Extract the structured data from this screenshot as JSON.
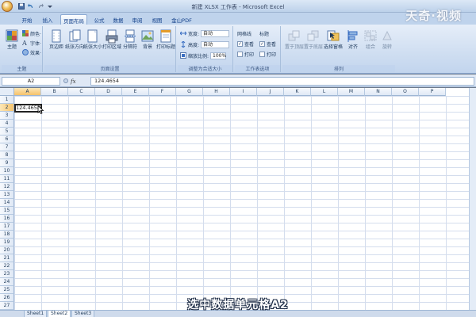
{
  "window": {
    "title": "新建 XLSX 工作表 - Microsoft Excel",
    "watermark": "天奇·视频"
  },
  "tabs": [
    {
      "label": "开始",
      "active": false
    },
    {
      "label": "插入",
      "active": false
    },
    {
      "label": "页面布局",
      "active": true
    },
    {
      "label": "公式",
      "active": false
    },
    {
      "label": "数据",
      "active": false
    },
    {
      "label": "审阅",
      "active": false
    },
    {
      "label": "视图",
      "active": false
    },
    {
      "label": "金山PDF",
      "active": false
    }
  ],
  "ribbon": {
    "theme_group": {
      "label": "主题",
      "big_button": "主题",
      "colors": "颜色·",
      "fonts": "字体·",
      "effects": "效果·"
    },
    "page_setup_group": {
      "label": "页面设置",
      "buttons": [
        "页边距",
        "纸张方向",
        "纸张大小",
        "打印区域",
        "分隔符",
        "背景",
        "打印标题"
      ]
    },
    "scale_group": {
      "label": "调整为合适大小",
      "width_label": "宽度:",
      "width_value": "自动",
      "height_label": "高度:",
      "height_value": "自动",
      "scale_label": "缩放比例:",
      "scale_value": "100%"
    },
    "sheet_options_group": {
      "label": "工作表选项",
      "gridlines_header": "网格线",
      "headings_header": "标题",
      "view_label": "查看",
      "print_label": "打印"
    },
    "arrange_group": {
      "label": "排列",
      "buttons": [
        "置于顶层",
        "置于底层",
        "选择窗格",
        "对齐",
        "组合",
        "旋转"
      ]
    }
  },
  "formula_bar": {
    "name_box": "A2",
    "fx": "fx",
    "value": "124.4654"
  },
  "grid": {
    "columns": [
      "A",
      "B",
      "C",
      "D",
      "E",
      "F",
      "G",
      "H",
      "I",
      "J",
      "K",
      "L",
      "M",
      "N",
      "O",
      "P"
    ],
    "rows": [
      "1",
      "2",
      "3",
      "4",
      "5",
      "6",
      "7",
      "8",
      "9",
      "10",
      "11",
      "12",
      "13",
      "14",
      "15",
      "16",
      "17",
      "18",
      "19",
      "20",
      "21",
      "22",
      "23",
      "24",
      "25",
      "26",
      "27"
    ],
    "active_cell_value": "124.4654"
  },
  "sheets": [
    "Sheet1",
    "Sheet2",
    "Sheet3"
  ],
  "subtitle": "选中数据单元格A2",
  "colors": {
    "accent": "#f5c26b",
    "ribbon": "#cfdef1"
  }
}
